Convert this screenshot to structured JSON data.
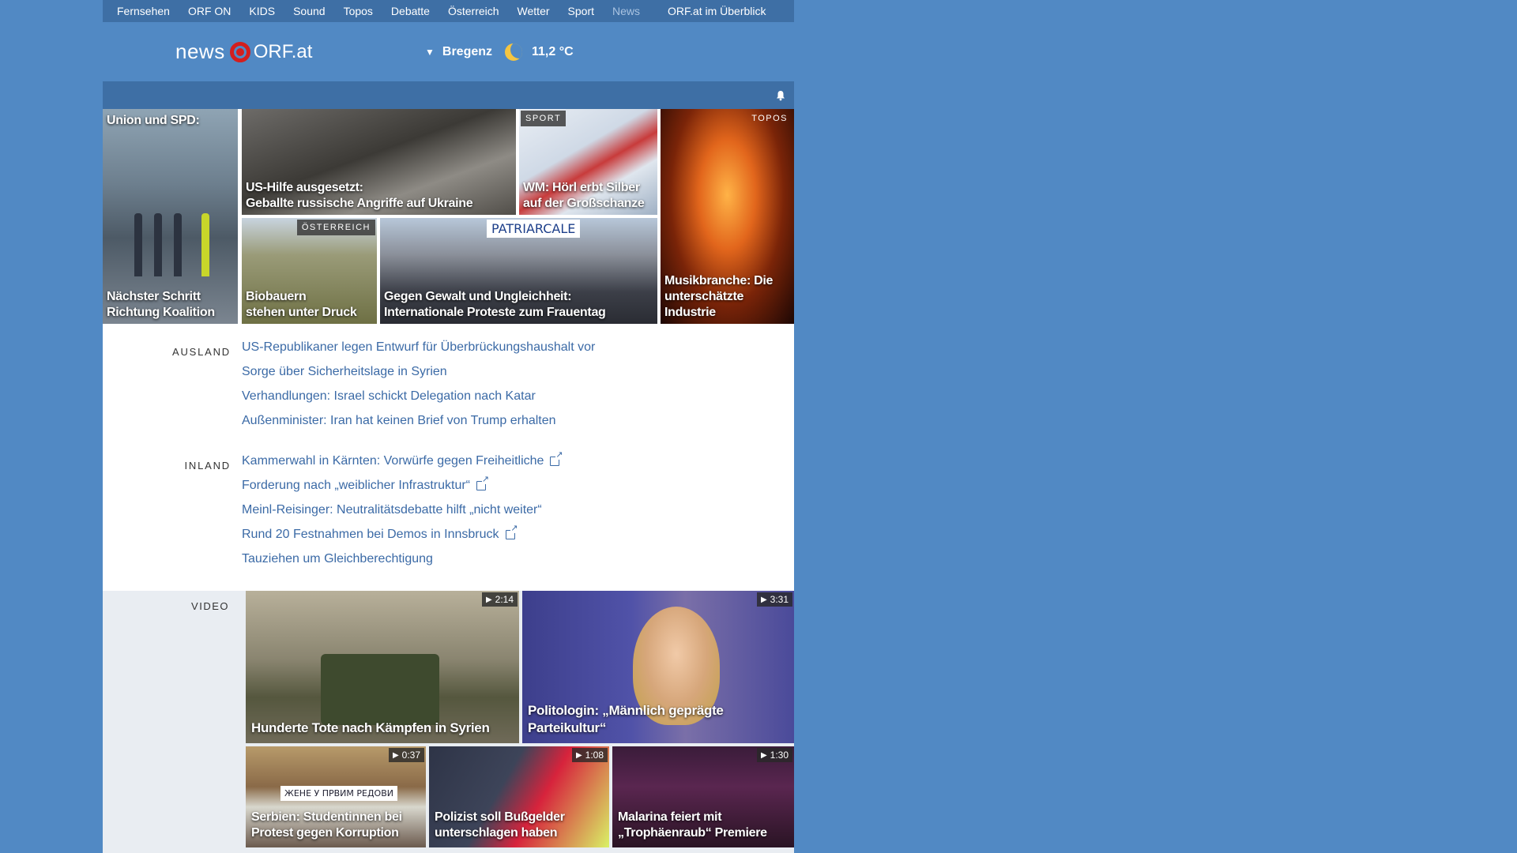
{
  "nav": {
    "items": [
      "Fernsehen",
      "ORF ON",
      "KIDS",
      "Sound",
      "Topos",
      "Debatte",
      "Österreich",
      "Wetter",
      "Sport",
      "News"
    ],
    "overview": "ORF.at im Überblick"
  },
  "header": {
    "logo_news": "news",
    "logo_orf": "ORF.at",
    "weather_location": "Bregenz",
    "weather_temp": "11,2 °C",
    "weather_icon": "moon-icon"
  },
  "tiles": [
    {
      "caption": "Nächster Schritt\nRichtung Koalition",
      "top_caption": "Union und SPD:"
    },
    {
      "caption": "US-Hilfe ausgesetzt:\nGeballte russische Angriffe auf Ukraine"
    },
    {
      "caption": "WM: Hörl erbt Silber\nauf der Großschanze",
      "badge": "SPORT"
    },
    {
      "caption": "Musikbranche: Die\nunterschätzte Industrie",
      "badge": "TOPOS"
    },
    {
      "caption": "Biobauern\nstehen unter Druck",
      "badge": "ÖSTERREICH"
    },
    {
      "caption": "Gegen Gewalt und Ungleichheit:\nInternationale Proteste zum Frauentag",
      "sign": "PATRIARCALE"
    }
  ],
  "ausland": {
    "label": "AUSLAND",
    "items": [
      "US-Republikaner legen Entwurf für Überbrückungshaushalt vor",
      "Sorge über Sicherheitslage in Syrien",
      "Verhandlungen: Israel schickt Delegation nach Katar",
      "Außenminister: Iran hat keinen Brief von Trump erhalten"
    ]
  },
  "inland": {
    "label": "INLAND",
    "items": [
      {
        "text": "Kammerwahl in Kärnten: Vorwürfe gegen Freiheitliche",
        "external": true
      },
      {
        "text": "Forderung nach „weiblicher Infrastruktur“",
        "external": true
      },
      {
        "text": "Meinl-Reisinger: Neutralitätsdebatte hilft „nicht weiter“",
        "external": false
      },
      {
        "text": "Rund 20 Festnahmen bei Demos in Innsbruck",
        "external": true
      },
      {
        "text": "Tauziehen um Gleichberechtigung",
        "external": false
      }
    ]
  },
  "video": {
    "label": "VIDEO",
    "items": [
      {
        "caption": "Hunderte Tote nach Kämpfen in Syrien",
        "duration": "2:14"
      },
      {
        "caption": "Politologin: „Männlich geprägte\nParteikultur“",
        "duration": "3:31"
      },
      {
        "caption": "Serbien: Studentinnen bei\nProtest gegen Korruption",
        "duration": "0:37",
        "banner": "ЖЕНЕ У ПРВИМ РЕДОВИ"
      },
      {
        "caption": "Polizist soll Bußgelder\nunterschlagen haben",
        "duration": "1:08"
      },
      {
        "caption": "Malarina feiert mit\n„Trophäenraub“ Premiere",
        "duration": "1:30"
      }
    ]
  },
  "colors": {
    "background": "#5189c4",
    "nav_bar": "#3e6fa5",
    "link": "#3b6aa6",
    "orf_red": "#d31e1e"
  }
}
